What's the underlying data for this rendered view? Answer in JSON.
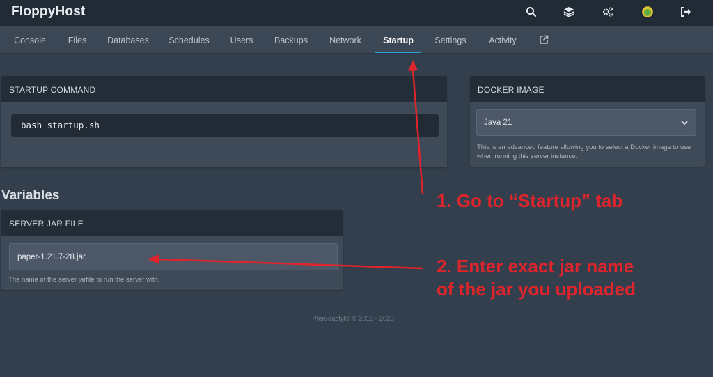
{
  "brand": "FloppyHost",
  "top_icons": [
    "search-icon",
    "layers-icon",
    "cogs-icon",
    "avatar",
    "sign-out-icon"
  ],
  "nav": {
    "tabs": [
      {
        "label": "Console"
      },
      {
        "label": "Files"
      },
      {
        "label": "Databases"
      },
      {
        "label": "Schedules"
      },
      {
        "label": "Users"
      },
      {
        "label": "Backups"
      },
      {
        "label": "Network"
      },
      {
        "label": "Startup",
        "active": true
      },
      {
        "label": "Settings"
      },
      {
        "label": "Activity"
      }
    ],
    "external_icon": "external-link-icon"
  },
  "startup_command": {
    "header": "STARTUP COMMAND",
    "command": "bash startup.sh"
  },
  "docker_image": {
    "header": "DOCKER IMAGE",
    "selected": "Java 21",
    "help": "This is an advanced feature allowing you to select a Docker image to use when running this server instance."
  },
  "variables": {
    "title": "Variables",
    "server_jar": {
      "header": "SERVER JAR FILE",
      "value": "paper-1.21.7-28.jar",
      "help": "The name of the server jarfile to run the server with."
    }
  },
  "footer": "Pterodactyl® © 2015 - 2025",
  "annotations": {
    "step1": "1. Go to “Startup” tab",
    "step2_line1": "2. Enter exact jar name",
    "step2_line2": "of the jar you uploaded"
  },
  "colors": {
    "accent": "#2fa4d6",
    "annotation": "#e0242b",
    "background": "#333f4d",
    "topbar": "#212b36"
  }
}
